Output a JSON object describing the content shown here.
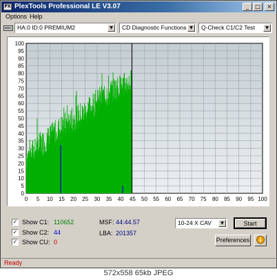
{
  "window": {
    "title": "PlexTools Professional LE V3.07",
    "icon_text": "PX"
  },
  "menu": [
    "Options",
    "Help"
  ],
  "toolbar": {
    "drive": "HA:0 ID:0  PREMIUM2",
    "mode": "CD Diagnostic Functions",
    "test": "Q-Check C1/C2 Test"
  },
  "chart_data": {
    "type": "area",
    "xlim": [
      0,
      100
    ],
    "ylim": [
      0,
      100
    ],
    "xticks": [
      0,
      5,
      10,
      15,
      20,
      25,
      30,
      35,
      40,
      45,
      50,
      55,
      60,
      65,
      70,
      75,
      80,
      85,
      90,
      95,
      100
    ],
    "yticks": [
      0,
      5,
      10,
      15,
      20,
      25,
      30,
      35,
      40,
      45,
      50,
      55,
      60,
      65,
      70,
      75,
      80,
      85,
      90,
      95,
      100
    ],
    "grid": true,
    "colors": {
      "c1": "#00b000",
      "c2": "#0000cc",
      "position_marker": "#000000",
      "background_top": "#cbd3d8",
      "background_bottom": "#e8ecee"
    },
    "position_marker_x": 44.7,
    "c1_envelope": [
      [
        0,
        25
      ],
      [
        5,
        32
      ],
      [
        10,
        38
      ],
      [
        15,
        45
      ],
      [
        20,
        50
      ],
      [
        25,
        55
      ],
      [
        30,
        62
      ],
      [
        35,
        68
      ],
      [
        40,
        72
      ],
      [
        44.7,
        75
      ]
    ],
    "c2_spikes": [
      [
        14.6,
        32
      ],
      [
        40.8,
        5
      ]
    ]
  },
  "stats": {
    "c1_label": "Show C1:",
    "c1_value": "110652",
    "c2_label": "Show C2:",
    "c2_value": "44",
    "cu_label": "Show CU:",
    "cu_value": "0",
    "msf_label": "MSF:",
    "msf_value": "44:44.57",
    "lba_label": "LBA:",
    "lba_value": "201357"
  },
  "controls": {
    "speed": "10-24 X CAV",
    "start": "Start",
    "preferences": "Preferences",
    "info_icon": "info-icon"
  },
  "status": "Ready",
  "caption": "572x558 65kb JPEG"
}
